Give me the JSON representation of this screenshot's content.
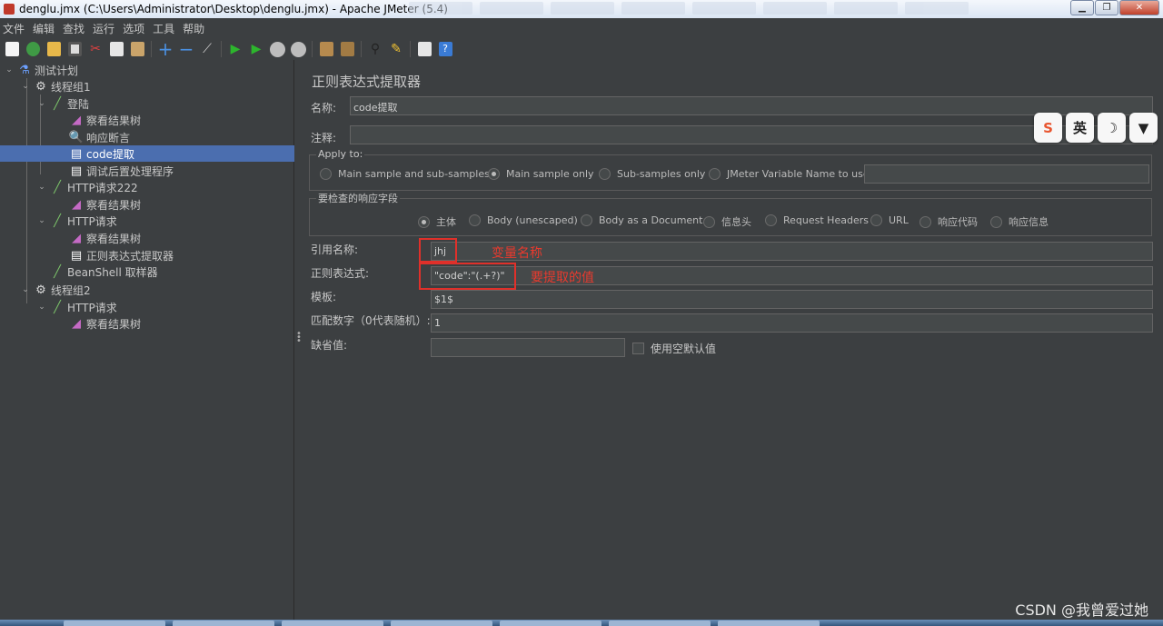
{
  "window": {
    "title": "denglu.jmx (C:\\Users\\Administrator\\Desktop\\denglu.jmx) - Apache JMeter (5.4)"
  },
  "menu": [
    "文件",
    "编辑",
    "查找",
    "运行",
    "选项",
    "工具",
    "帮助"
  ],
  "toolbar": [
    "new-icon",
    "templates-icon",
    "open-icon",
    "save-icon",
    "cut-icon",
    "copy-icon",
    "paste-icon",
    "expand-icon",
    "collapse-icon",
    "toggle-icon",
    "start-icon",
    "start-no-pause-icon",
    "stop-icon",
    "shutdown-icon",
    "clear-icon",
    "clear-all-icon",
    "search-icon",
    "reset-search-icon",
    "function-helper-icon",
    "help-icon"
  ],
  "tree": {
    "items": [
      {
        "label": "测试计划",
        "icon": "test-plan-icon"
      },
      {
        "label": "线程组1",
        "icon": "gear-icon"
      },
      {
        "label": "登陆",
        "icon": "pipette-icon"
      },
      {
        "label": "察看结果树",
        "icon": "chart-icon"
      },
      {
        "label": "响应断言",
        "icon": "magnifier-icon"
      },
      {
        "label": "code提取",
        "icon": "document-icon"
      },
      {
        "label": "调试后置处理程序",
        "icon": "document-icon"
      },
      {
        "label": "HTTP请求222",
        "icon": "pipette-icon"
      },
      {
        "label": "察看结果树",
        "icon": "chart-icon"
      },
      {
        "label": "HTTP请求",
        "icon": "pipette-icon"
      },
      {
        "label": "察看结果树",
        "icon": "chart-icon"
      },
      {
        "label": "正则表达式提取器",
        "icon": "document-icon"
      },
      {
        "label": "BeanShell 取样器",
        "icon": "pipette-icon"
      },
      {
        "label": "线程组2",
        "icon": "gear-icon"
      },
      {
        "label": "HTTP请求",
        "icon": "pipette-icon"
      },
      {
        "label": "察看结果树",
        "icon": "chart-icon"
      }
    ]
  },
  "panel": {
    "title": "正则表达式提取器",
    "name_label": "名称:",
    "name_value": "code提取",
    "comment_label": "注释:",
    "comment_value": "",
    "apply_to_label": "Apply to:",
    "apply_to_options": [
      "Main sample and sub-samples",
      "Main sample only",
      "Sub-samples only",
      "JMeter Variable Name to use"
    ],
    "apply_to_selected": "Main sample only",
    "field_group_label": "要检查的响应字段",
    "field_options": [
      "主体",
      "Body (unescaped)",
      "Body as a Document",
      "信息头",
      "Request Headers",
      "URL",
      "响应代码",
      "响应信息"
    ],
    "field_selected": "主体",
    "ref_name_label": "引用名称:",
    "ref_name_value": "jhj",
    "regex_label": "正则表达式:",
    "regex_value": "\"code\":\"(.+?)\"",
    "template_label": "模板:",
    "template_value": "$1$",
    "match_no_label": "匹配数字（0代表随机）:",
    "match_no_value": "1",
    "default_label": "缺省值:",
    "default_value": "",
    "use_empty_default_label": "使用空默认值"
  },
  "annotations": {
    "ref_note": "变量名称",
    "regex_note": "要提取的值",
    "color": "#e0302a"
  },
  "float_toolbar": [
    "S",
    "英",
    "☽",
    "👕"
  ],
  "watermark": "CSDN @我曾爱过她"
}
